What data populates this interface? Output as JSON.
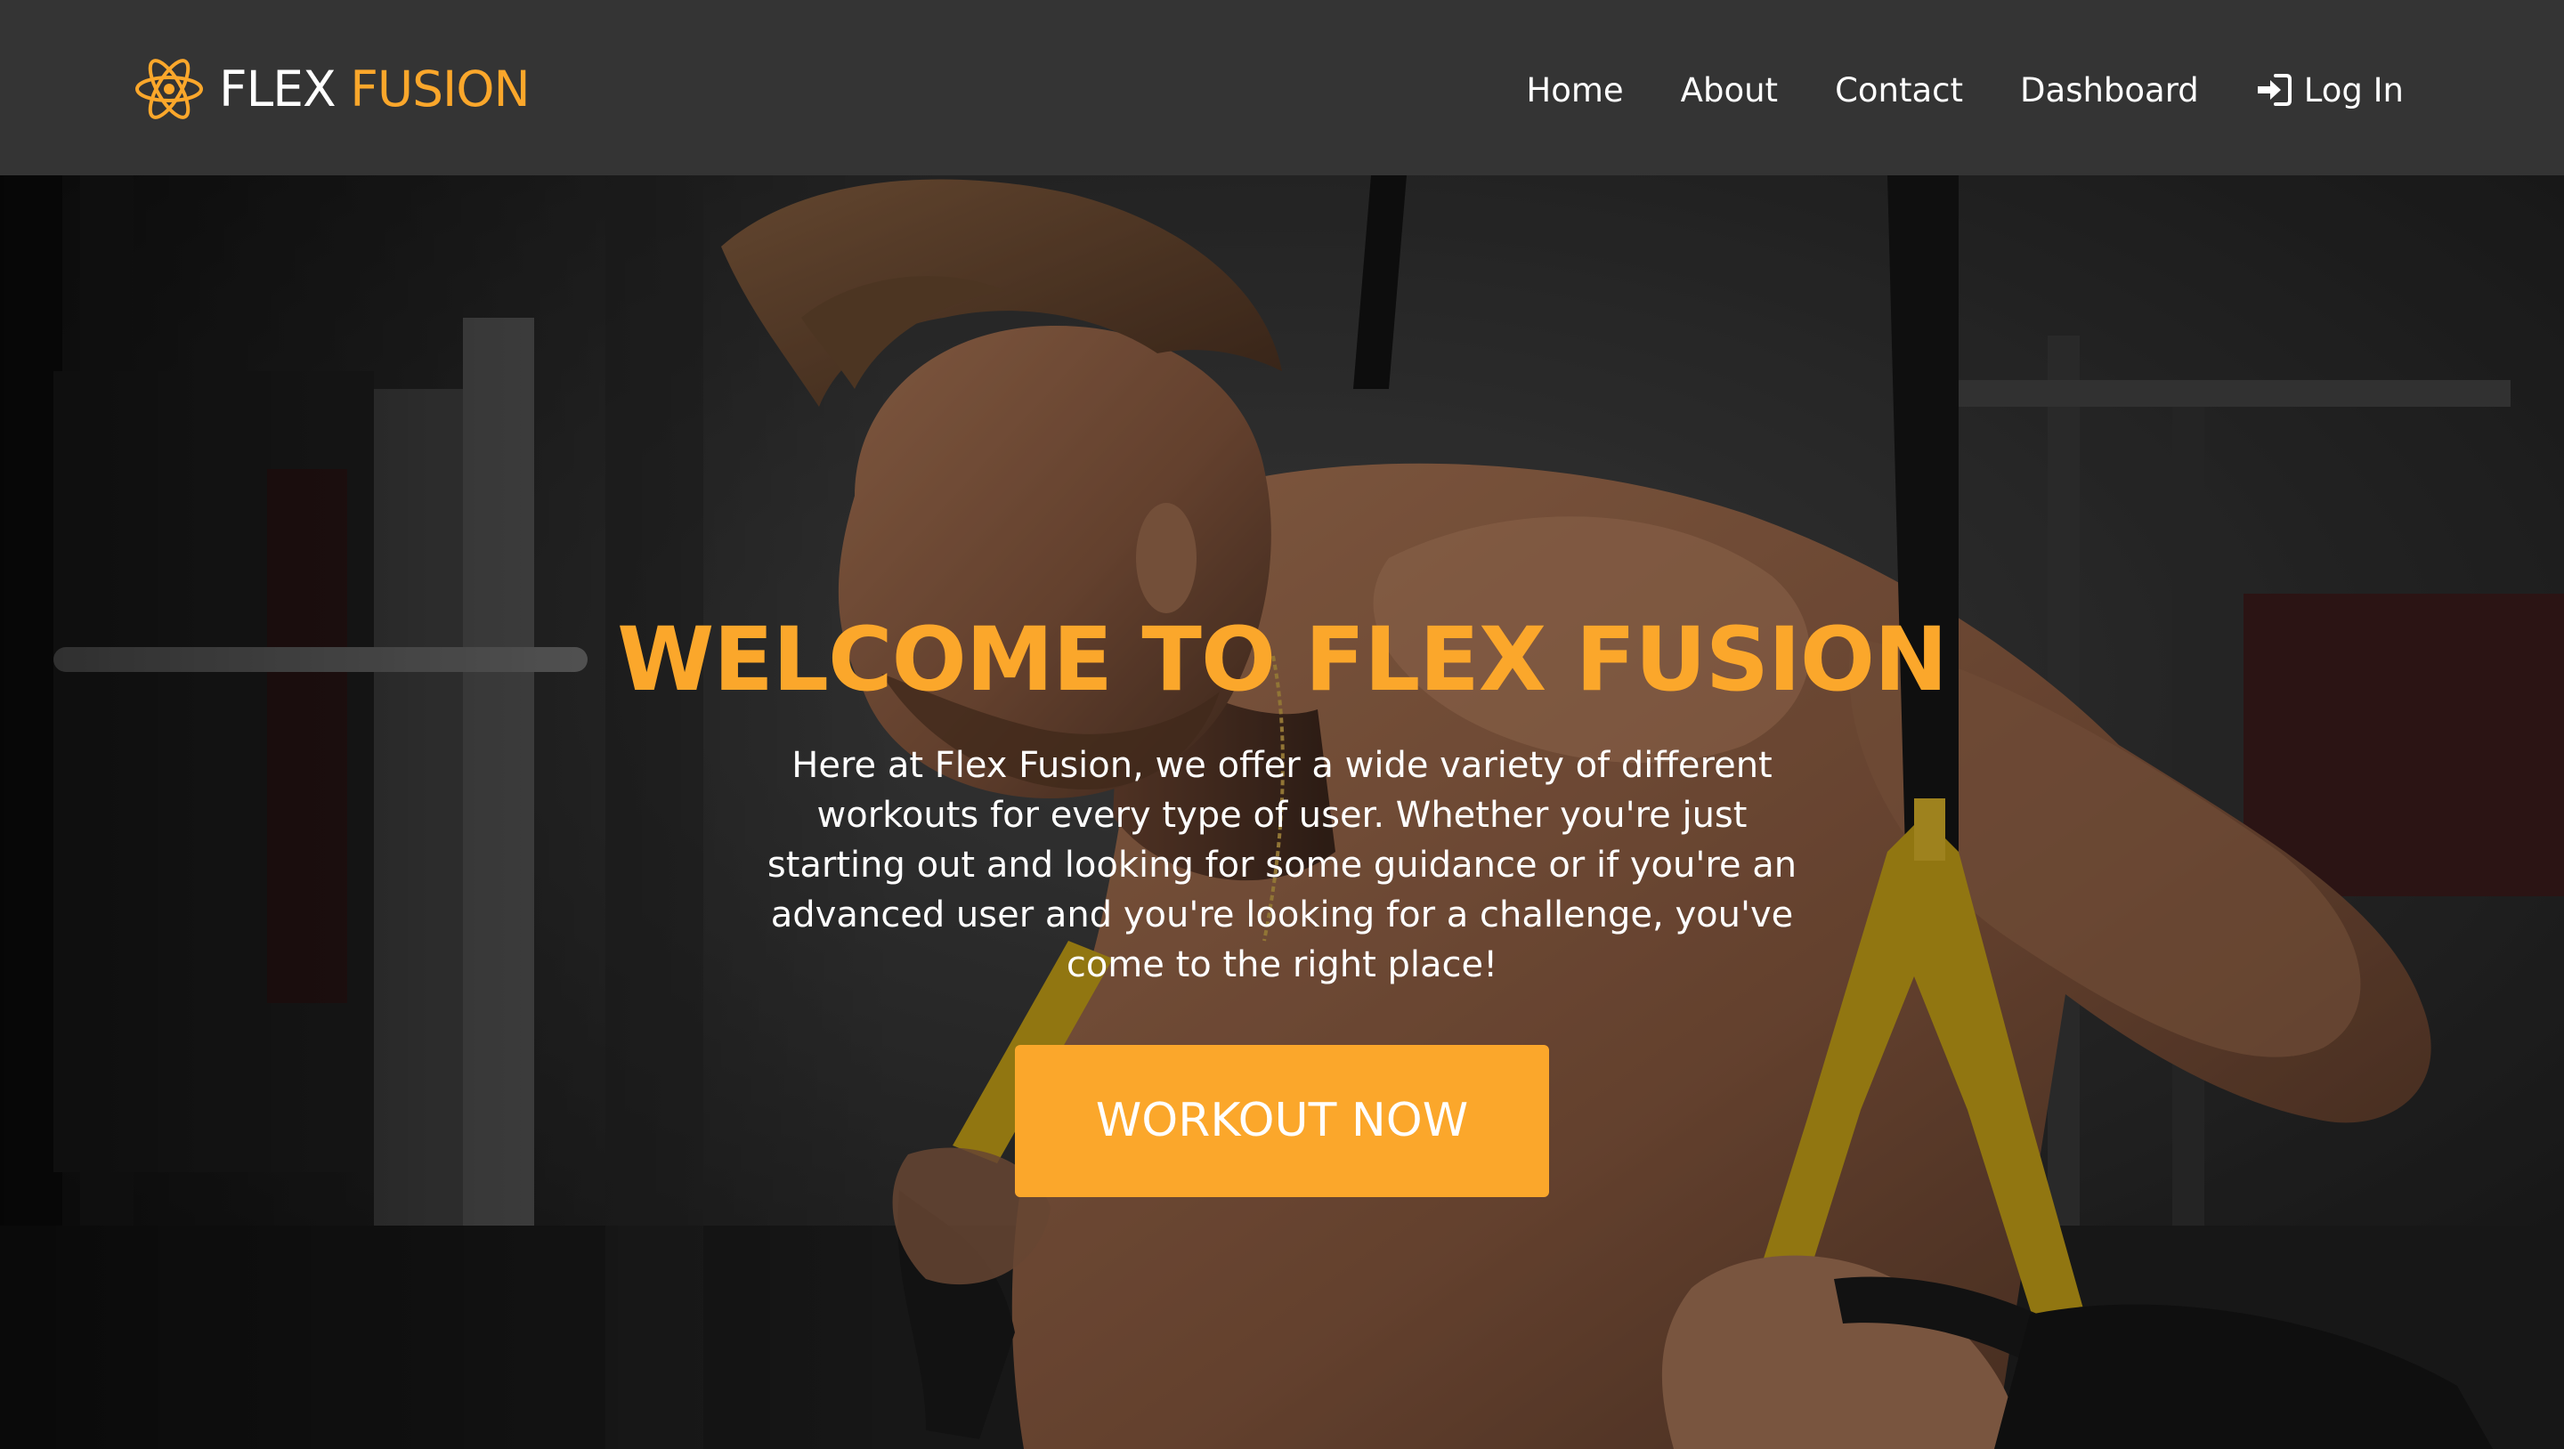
{
  "brand": {
    "name_part1": "FLEX",
    "name_part2": "FUSION",
    "logo_icon": "atom-icon"
  },
  "nav": {
    "items": [
      {
        "label": "Home"
      },
      {
        "label": "About"
      },
      {
        "label": "Contact"
      },
      {
        "label": "Dashboard"
      }
    ],
    "login": {
      "label": "Log In",
      "icon": "sign-in-icon"
    }
  },
  "hero": {
    "title": "WELCOME TO FLEX FUSION",
    "text": "Here at Flex Fusion, we offer a wide variety of different workouts for every type of user. Whether you're just starting out and looking for some guidance or if you're an advanced user and you're looking for a challenge, you've come to the right place!",
    "cta_label": "WORKOUT NOW",
    "background_image": "man-training-with-suspension-straps-photo"
  },
  "colors": {
    "accent": "#fba72b",
    "navbar_bg": "#343434",
    "text_light": "#ffffff"
  }
}
